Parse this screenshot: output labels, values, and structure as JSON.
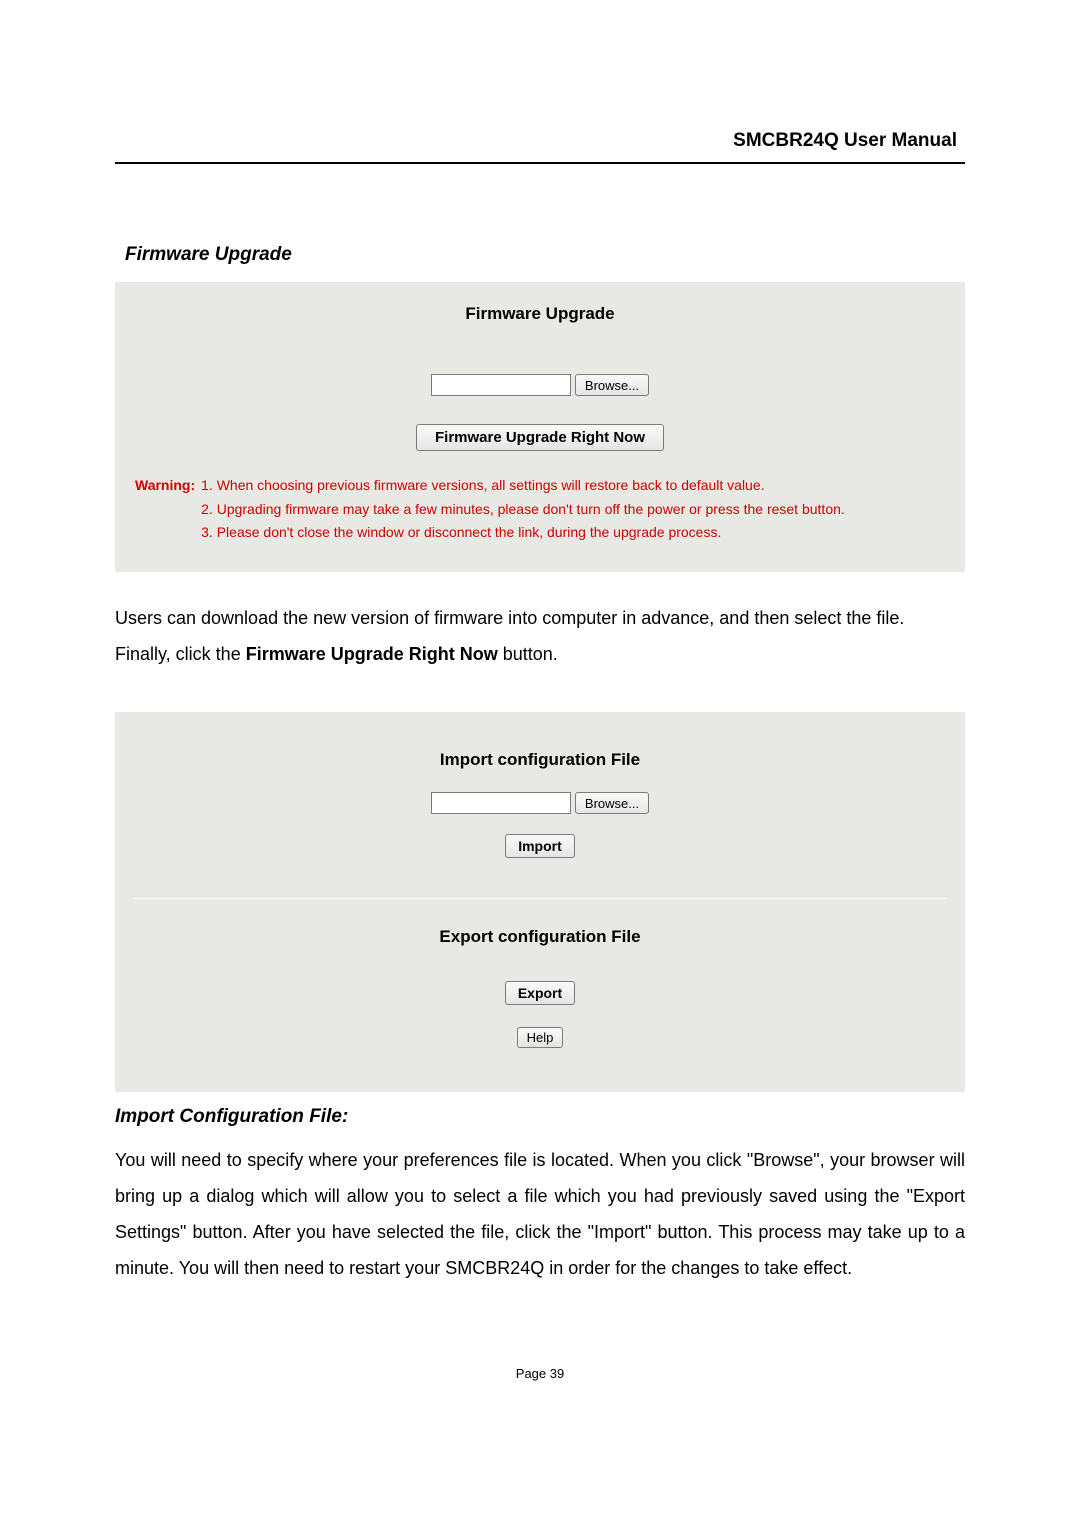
{
  "header": {
    "title": "SMCBR24Q User Manual"
  },
  "firmware": {
    "section_heading": "Firmware Upgrade",
    "panel_title": "Firmware Upgrade",
    "file_value": "",
    "browse_label": "Browse...",
    "upgrade_button": "Firmware Upgrade Right Now",
    "warning_label": "Warning:",
    "warning1": "1. When choosing previous firmware versions, all settings will restore back to default value.",
    "warning2": "2. Upgrading firmware may take a few minutes, please don't turn off the power or press the reset button.",
    "warning3": "3. Please don't close the window or disconnect the link, during the upgrade process."
  },
  "body1_pre": "Users can download the new version of firmware into computer in advance, and then select the file. Finally, click the ",
  "body1_bold": "Firmware Upgrade Right Now",
  "body1_post": " button.",
  "importexport": {
    "import_title": "Import configuration File",
    "import_file_value": "",
    "import_browse": "Browse...",
    "import_button": "Import",
    "export_title": "Export configuration File",
    "export_button": "Export",
    "help_button": "Help"
  },
  "import_section": {
    "heading": "Import Configuration File",
    "colon": ":",
    "text": "You will need to specify where your preferences file is located. When you click \"Browse\", your browser will bring up a dialog which will allow you to select a file which you had previously saved using the \"Export Settings\" button. After you have selected the file, click the \"Import\" button. This process may take up to a minute.   You will then need to restart your SMCBR24Q in order for the changes to take effect."
  },
  "footer": {
    "page_label": "Page 39"
  }
}
